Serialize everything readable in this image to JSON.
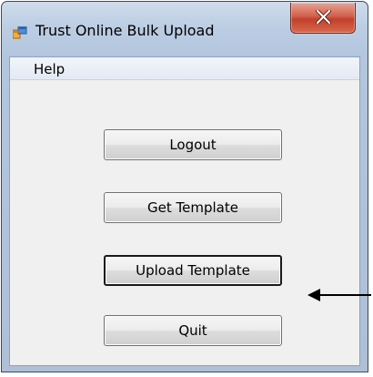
{
  "window": {
    "title": "Trust Online Bulk Upload"
  },
  "menu": {
    "items": [
      "Help"
    ]
  },
  "buttons": {
    "logout": "Logout",
    "get_template": "Get Template",
    "upload_template": "Upload Template",
    "quit": "Quit"
  },
  "icons": {
    "app": "application-window-icon",
    "close": "close-x-icon",
    "annotation": "left-arrow-icon"
  },
  "colors": {
    "frame": "#b3c6de",
    "close_button": "#c2402a",
    "client_bg": "#f0f0f0"
  }
}
